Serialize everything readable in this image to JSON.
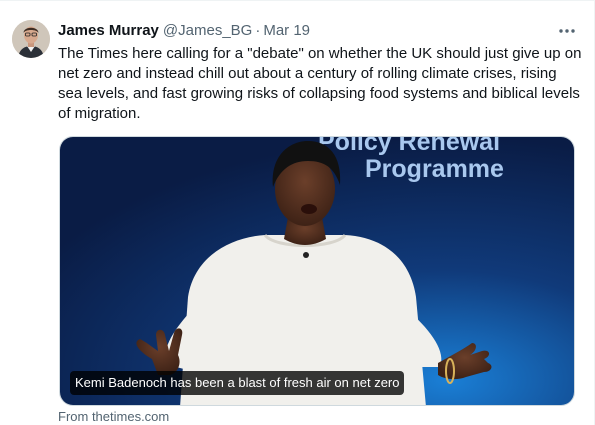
{
  "tweet": {
    "display_name": "James Murray",
    "handle": "@James_BG",
    "separator": "·",
    "date": "Mar 19",
    "more_icon": "more-horizontal-icon",
    "text": "The Times here calling for a \"debate\" on whether the UK should just give up on net zero and instead chill out about a century of rolling climate crises, rising sea levels, and fast growing risks of collapsing food systems and biblical levels of migration."
  },
  "link_card": {
    "backdrop_text_line1": "Policy Renewal",
    "backdrop_text_line2": "Programme",
    "headline": "Kemi Badenoch has been a blast of fresh air on net zero",
    "source": "From thetimes.com"
  },
  "colors": {
    "text_primary": "#0f1419",
    "text_secondary": "#536471",
    "card_bg": "#0c2554",
    "backdrop_text": "#a9c8ee"
  }
}
